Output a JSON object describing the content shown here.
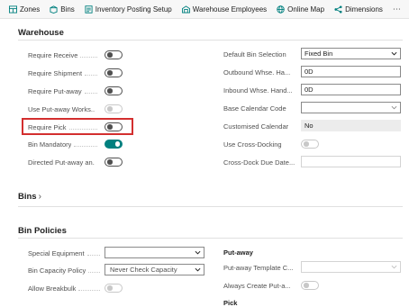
{
  "actionbar": {
    "items": [
      {
        "label": "Zones",
        "icon": "zones-icon"
      },
      {
        "label": "Bins",
        "icon": "bins-icon"
      },
      {
        "label": "Inventory Posting Setup",
        "icon": "inventory-posting-setup-icon"
      },
      {
        "label": "Warehouse Employees",
        "icon": "warehouse-employees-icon"
      },
      {
        "label": "Online Map",
        "icon": "online-map-icon"
      },
      {
        "label": "Dimensions",
        "icon": "dimensions-icon"
      }
    ],
    "more": "⋯"
  },
  "warehouse": {
    "title": "Warehouse",
    "left": [
      {
        "label": "Require Receive",
        "state": "off"
      },
      {
        "label": "Require Shipment",
        "state": "off"
      },
      {
        "label": "Require Put-away",
        "state": "off"
      },
      {
        "label": "Use Put-away Works...",
        "state": "disabled"
      },
      {
        "label": "Require Pick",
        "state": "off"
      },
      {
        "label": "Bin Mandatory",
        "state": "on"
      },
      {
        "label": "Directed Put-away an...",
        "state": "off"
      }
    ],
    "right": {
      "default_bin_selection": {
        "label": "Default Bin Selection",
        "value": "Fixed Bin"
      },
      "outbound_whse": {
        "label": "Outbound Whse. Ha...",
        "value": "0D"
      },
      "inbound_whse": {
        "label": "Inbound Whse. Hand...",
        "value": "0D"
      },
      "base_calendar": {
        "label": "Base Calendar Code",
        "value": ""
      },
      "customised_calendar": {
        "label": "Customised Calendar",
        "value": "No"
      },
      "use_cross_docking": {
        "label": "Use Cross-Docking",
        "state": "off"
      },
      "cross_dock_due_date": {
        "label": "Cross-Dock Due Date...",
        "value": ""
      }
    }
  },
  "bins": {
    "title": "Bins",
    "chevron": "›"
  },
  "bin_policies": {
    "title": "Bin Policies",
    "special_equipment": {
      "label": "Special Equipment",
      "value": ""
    },
    "bin_capacity_policy": {
      "label": "Bin Capacity Policy",
      "value": "Never Check Capacity"
    },
    "allow_breakbulk": {
      "label": "Allow Breakbulk",
      "state": "disabled"
    },
    "putaway_heading": "Put-away",
    "putaway_template": {
      "label": "Put-away Template C...",
      "value": ""
    },
    "always_create_putaway": {
      "label": "Always Create Put-a...",
      "state": "disabled"
    },
    "pick_heading": "Pick"
  },
  "colors": {
    "accent": "#00807f",
    "highlight": "#d32f2f"
  }
}
